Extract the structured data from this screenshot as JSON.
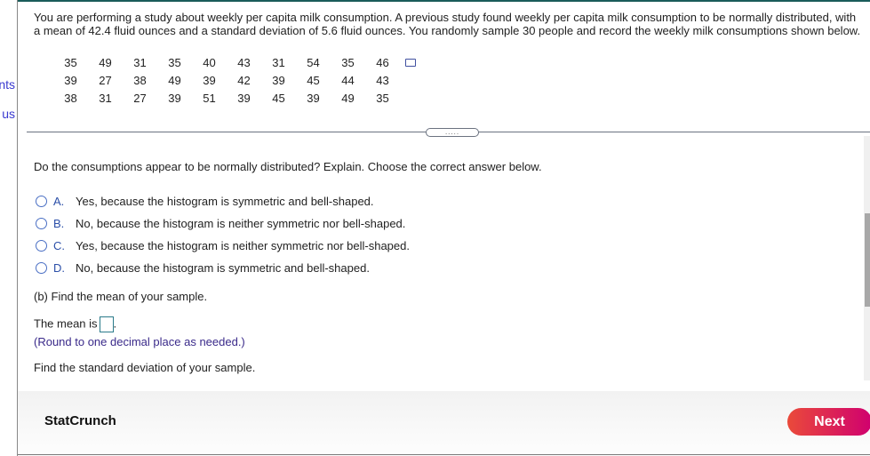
{
  "left_nav": {
    "item1": "ents",
    "item2": "us"
  },
  "intro": "You are performing a study about weekly per capita milk consumption. A previous study found weekly per capita milk consumption to be normally distributed, with a mean of 42.4 fluid ounces and a standard deviation of 5.6 fluid ounces. You randomly sample 30 people and record the weekly milk consumptions shown below.",
  "sample": [
    [
      "35",
      "49",
      "31",
      "35",
      "40",
      "43",
      "31",
      "54",
      "35",
      "46"
    ],
    [
      "39",
      "27",
      "38",
      "49",
      "39",
      "42",
      "39",
      "45",
      "44",
      "43"
    ],
    [
      "38",
      "31",
      "27",
      "39",
      "51",
      "39",
      "45",
      "39",
      "49",
      "35"
    ]
  ],
  "divider_handle": ".....",
  "question": "Do the consumptions appear to be normally distributed? Explain. Choose the correct answer below.",
  "options": [
    {
      "letter": "A.",
      "text": "Yes, because the histogram is symmetric and bell-shaped."
    },
    {
      "letter": "B.",
      "text": "No, because the histogram is neither symmetric nor bell-shaped."
    },
    {
      "letter": "C.",
      "text": "Yes, because the histogram is neither symmetric nor bell-shaped."
    },
    {
      "letter": "D.",
      "text": "No, because the histogram is symmetric and bell-shaped."
    }
  ],
  "part_b": "(b) Find the mean of your sample.",
  "mean_label": "The mean is",
  "mean_value": "",
  "round_hint": "(Round to one decimal place as needed.)",
  "sd_prompt": "Find the standard deviation of your sample.",
  "footer": {
    "brand": "StatCrunch",
    "next": "Next"
  },
  "colors": {
    "accent": "#2b4fa8",
    "next_gradient_start": "#ea4a3a",
    "next_gradient_end": "#d0006f"
  }
}
